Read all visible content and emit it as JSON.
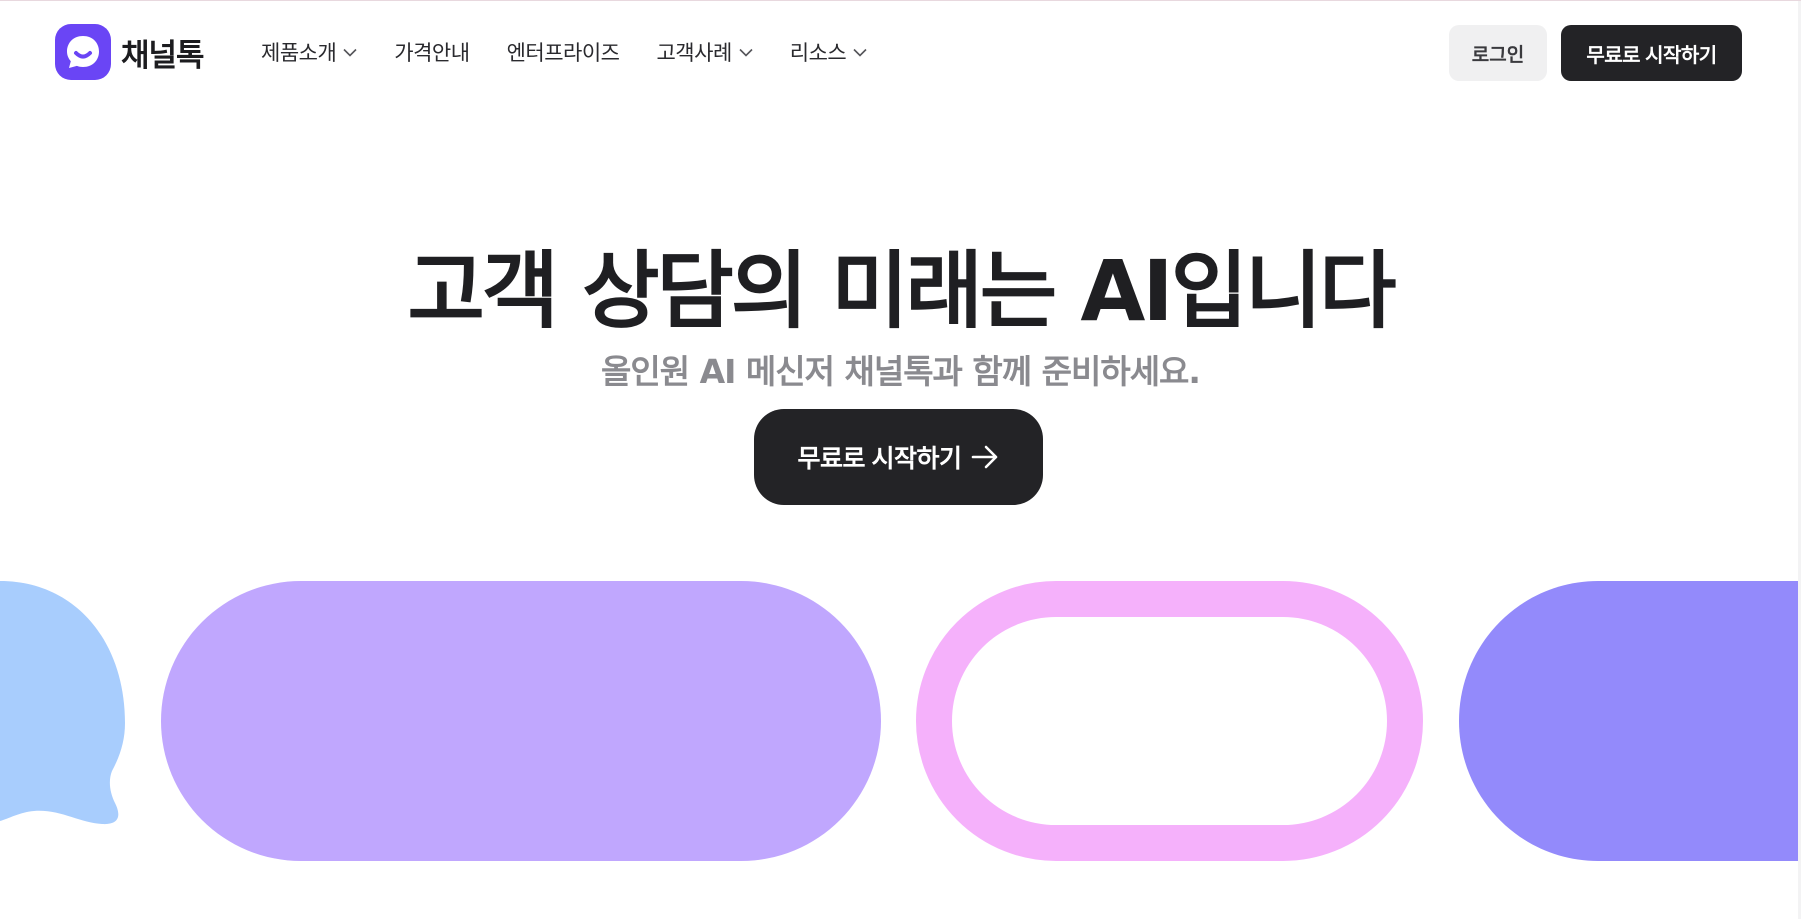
{
  "brand": {
    "name": "채널톡",
    "logo_icon": "chat-smile-icon",
    "logo_color": "#6a45f5"
  },
  "nav": {
    "items": [
      {
        "label": "제품소개",
        "has_dropdown": true
      },
      {
        "label": "가격안내",
        "has_dropdown": false
      },
      {
        "label": "엔터프라이즈",
        "has_dropdown": false
      },
      {
        "label": "고객사례",
        "has_dropdown": true
      },
      {
        "label": "리소스",
        "has_dropdown": true
      }
    ],
    "login_label": "로그인",
    "start_label": "무료로 시작하기"
  },
  "hero": {
    "title": "고객 상담의 미래는 AI입니다",
    "subtitle": "올인원 AI 메신저 채널톡과 함께 준비하세요.",
    "cta_label": "무료로 시작하기",
    "cta_icon": "arrow-right-icon"
  },
  "colors": {
    "dark": "#232326",
    "blue_bubble": "#a8cdfd",
    "lavender": "#c0a7fe",
    "pink": "#f5b1fb",
    "periwinkle": "#938afb"
  }
}
